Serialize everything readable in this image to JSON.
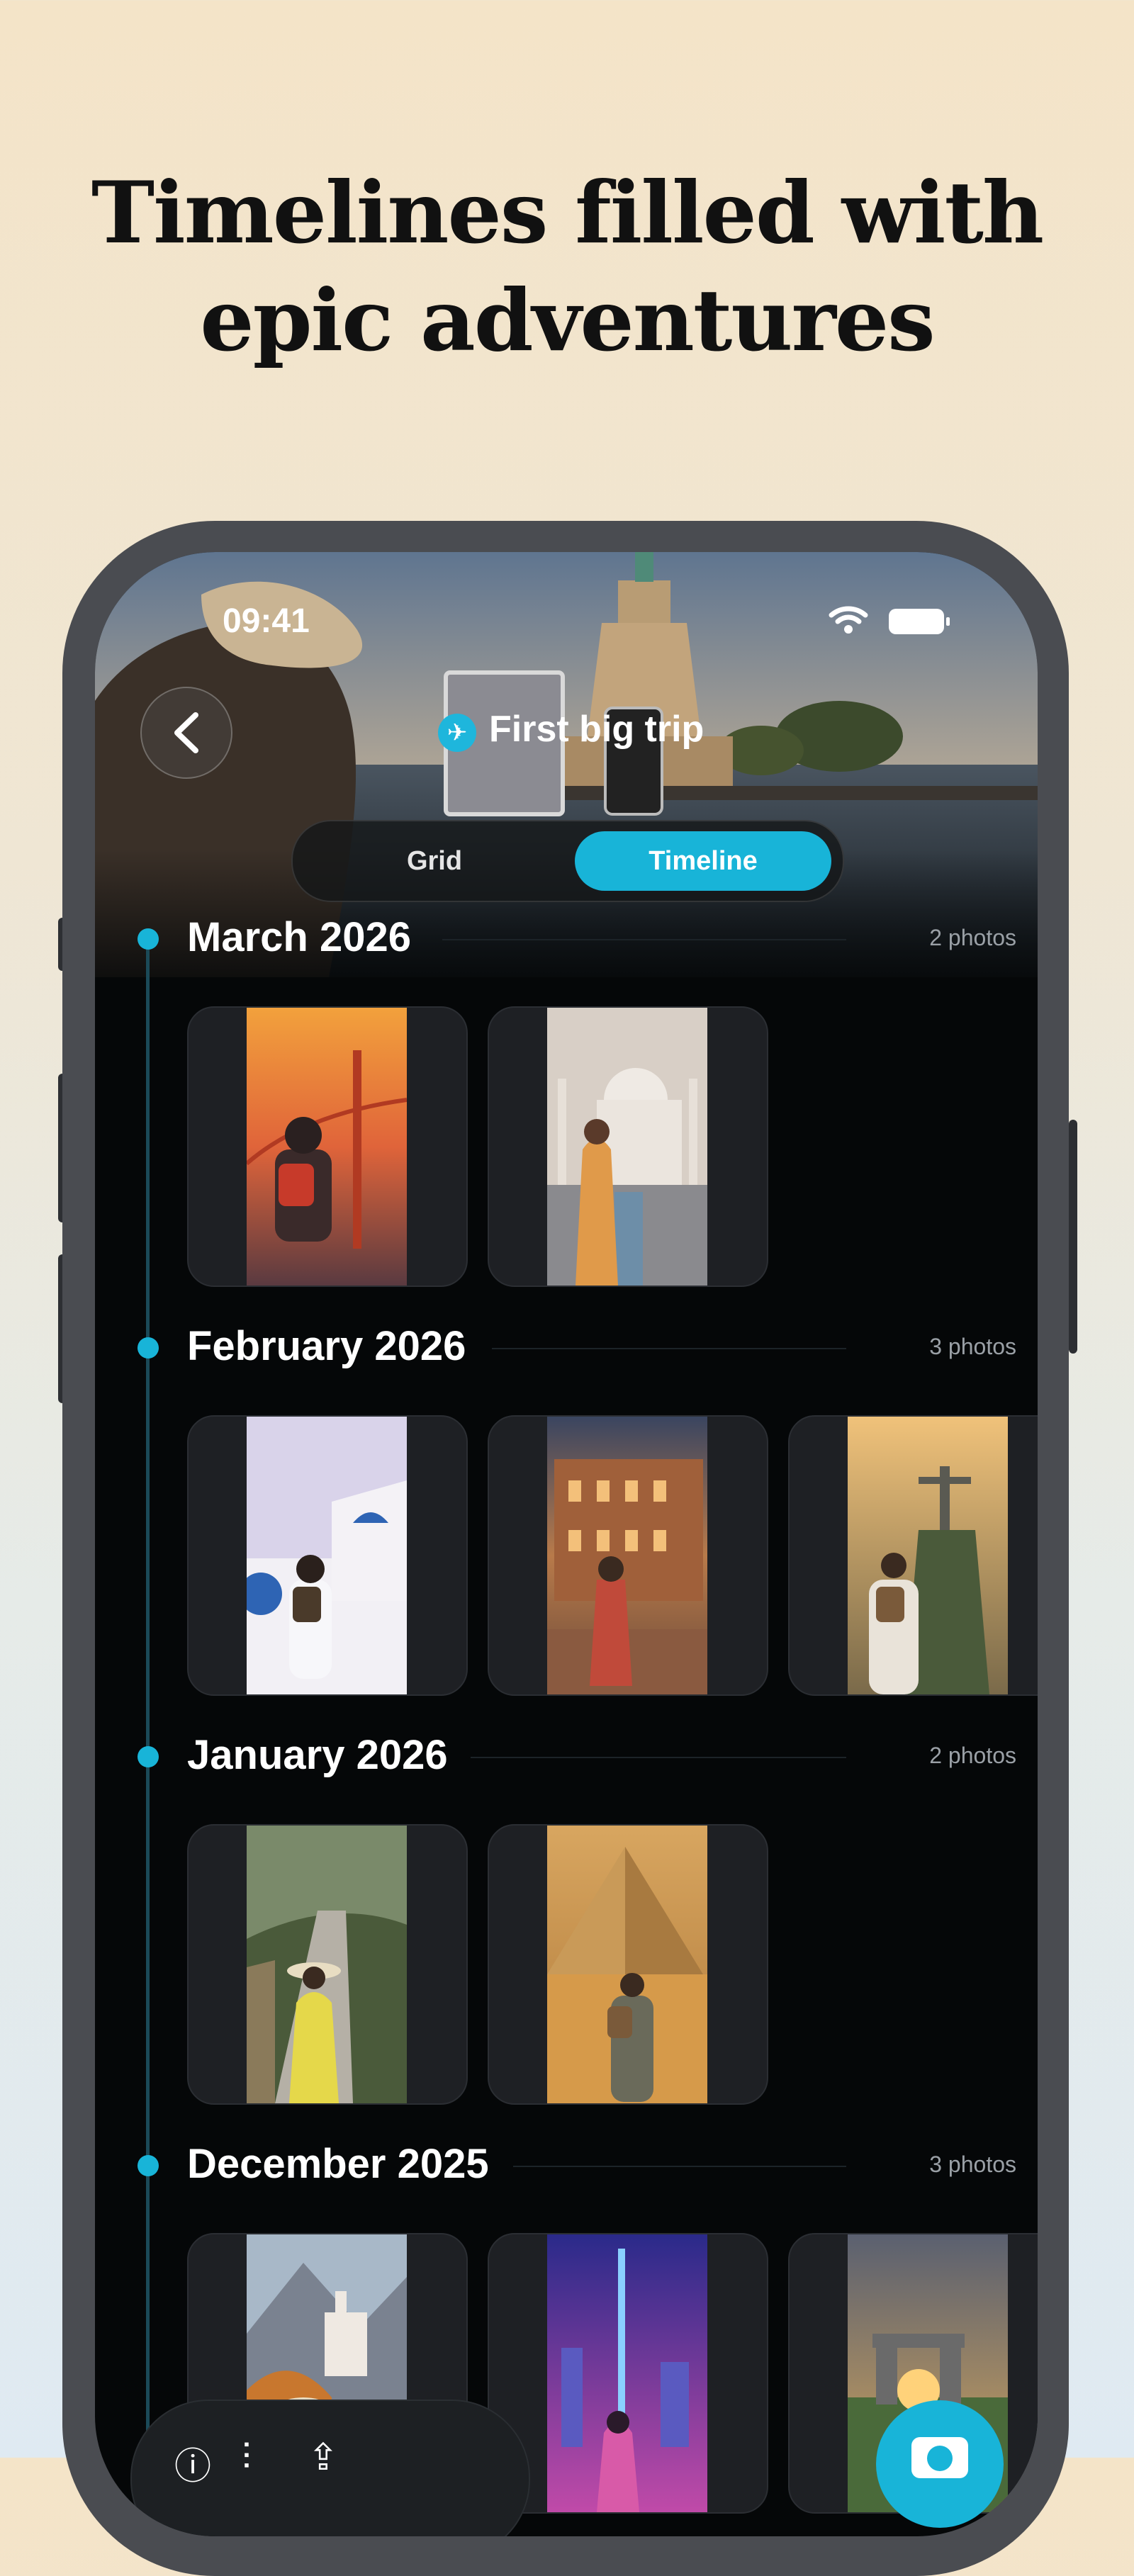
{
  "headline": {
    "line1": "Timelines filled with",
    "line2": "epic adventures"
  },
  "status_bar": {
    "time": "09:41",
    "icons": [
      "wifi-icon",
      "battery-icon"
    ]
  },
  "header": {
    "back_icon": "chevron-left-icon",
    "trip_icon": "airplane-icon",
    "title": "First big trip"
  },
  "segmented": {
    "options": [
      "Grid",
      "Timeline"
    ],
    "selected": "Timeline"
  },
  "sections": [
    {
      "title": "March 2026",
      "count": "2 photos"
    },
    {
      "title": "February 2026",
      "count": "3 photos"
    },
    {
      "title": "January 2026",
      "count": "2 photos"
    },
    {
      "title": "December 2025",
      "count": "3 photos"
    }
  ],
  "tabbar": {
    "icons": [
      "info-icon",
      "sliders-icon",
      "share-icon"
    ],
    "fab_icon": "camera-icon"
  },
  "colors": {
    "accent": "#18b4d8",
    "screen_bg": "#050708"
  }
}
